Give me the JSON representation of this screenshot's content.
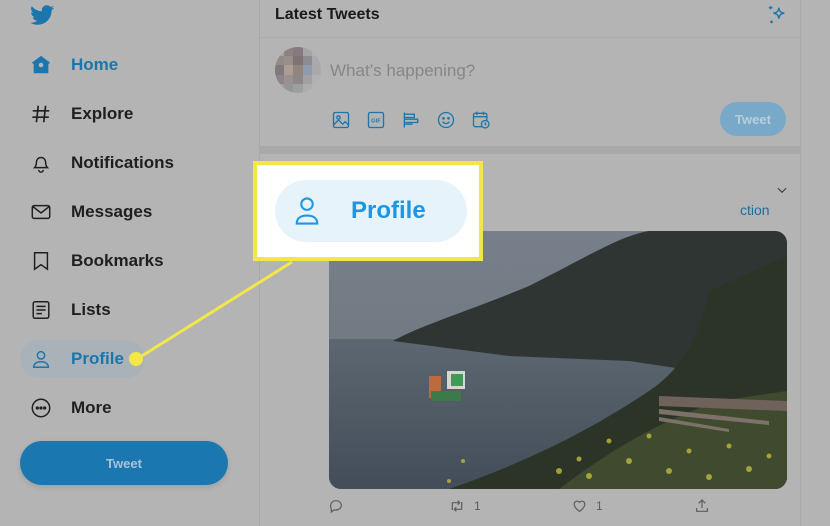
{
  "sidebar": {
    "logo": "twitter-bird",
    "items": [
      {
        "label": "Home",
        "icon": "home-icon",
        "active": true
      },
      {
        "label": "Explore",
        "icon": "hashtag-icon"
      },
      {
        "label": "Notifications",
        "icon": "bell-icon"
      },
      {
        "label": "Messages",
        "icon": "envelope-icon"
      },
      {
        "label": "Bookmarks",
        "icon": "bookmark-icon"
      },
      {
        "label": "Lists",
        "icon": "list-icon"
      },
      {
        "label": "Profile",
        "icon": "person-icon",
        "highlighted": true
      },
      {
        "label": "More",
        "icon": "more-circle-icon"
      }
    ],
    "tweet_button": "Tweet"
  },
  "main": {
    "header_title": "Latest Tweets",
    "compose": {
      "placeholder": "What’s happening?",
      "tools": [
        "image-icon",
        "gif-icon",
        "poll-icon",
        "emoji-icon",
        "schedule-icon"
      ],
      "tweet_button": "Tweet"
    },
    "tweet": {
      "text_fragment": "ction",
      "actions": {
        "reply_count": "",
        "retweet_count": "1",
        "like_count": "1"
      }
    }
  },
  "callout": {
    "label": "Profile"
  },
  "colors": {
    "accent": "#1a76ac",
    "callout_border": "#f3e748",
    "callout_text": "#1e96e3"
  }
}
